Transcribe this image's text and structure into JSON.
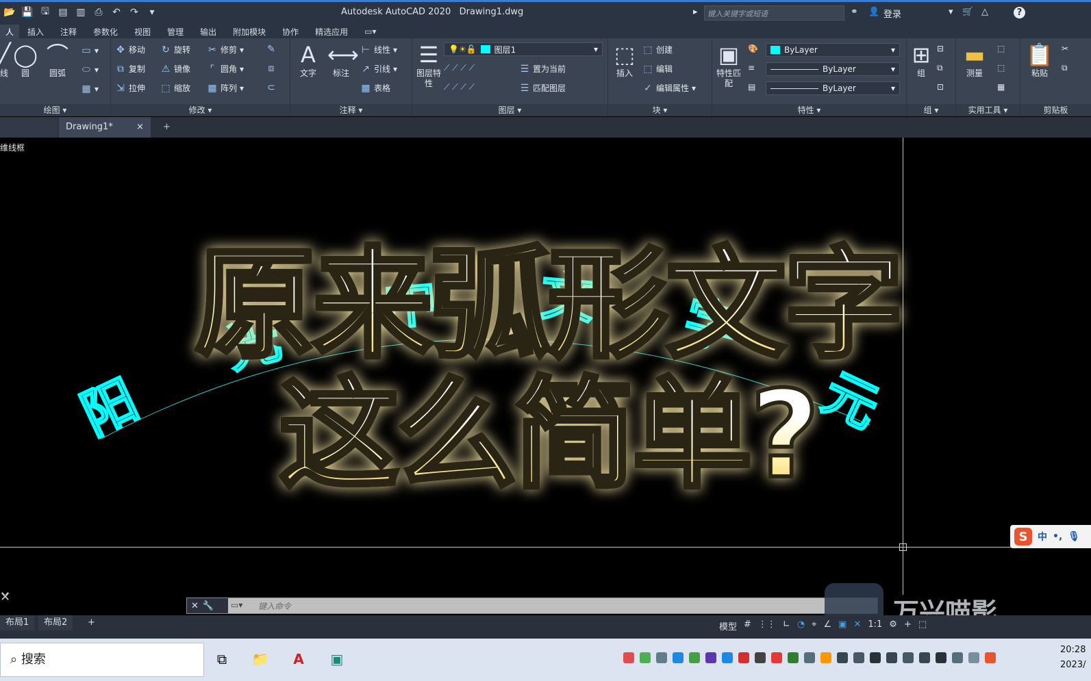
{
  "titlebar": {
    "app_title": "Autodesk AutoCAD 2020",
    "file_name": "Drawing1.dwg",
    "search_placeholder": "键入关键字或短语",
    "login_label": "登录",
    "help_label": "?"
  },
  "ribbon_tabs": [
    "人",
    "插入",
    "注释",
    "参数化",
    "视图",
    "管理",
    "输出",
    "附加模块",
    "协作",
    "精选应用"
  ],
  "ribbon": {
    "draw": {
      "label": "绘图",
      "items": [
        "线",
        "圆",
        "圆弧"
      ]
    },
    "modify": {
      "label": "修改",
      "items": [
        "移动",
        "旋转",
        "修剪",
        "复制",
        "镜像",
        "圆角",
        "拉伸",
        "缩放",
        "阵列"
      ]
    },
    "annotation": {
      "label": "注释",
      "text": "文字",
      "dim": "标注",
      "items": [
        "线性",
        "引线",
        "表格"
      ]
    },
    "layers": {
      "label": "图层",
      "props": "图层特性",
      "current_layer": "图层1",
      "items": [
        "置为当前",
        "匹配图层"
      ]
    },
    "block": {
      "label": "块",
      "insert": "插入",
      "items": [
        "创建",
        "编辑",
        "编辑属性"
      ]
    },
    "properties": {
      "label": "特性",
      "match": "特性匹配",
      "color": "ByLayer",
      "linetype": "ByLayer",
      "lineweight": "ByLayer"
    },
    "groups": {
      "label": "组",
      "group": "组"
    },
    "utilities": {
      "label": "实用工具",
      "measure": "测量"
    },
    "clipboard": {
      "label": "剪贴板",
      "paste": "粘贴"
    }
  },
  "doc_tabs": {
    "active": "Drawing1*",
    "close": "×",
    "add": "+"
  },
  "viewport": {
    "label": "维线框",
    "arc_chars": [
      "阳",
      "光",
      "中",
      "文",
      "字",
      "元"
    ]
  },
  "overlay": {
    "line1": "原来弧形文字",
    "line2": "这么简单?"
  },
  "ime": {
    "logo": "S",
    "lang": "中",
    "punct": "•,"
  },
  "command": {
    "placeholder": "键入命令"
  },
  "watermark": {
    "text": "万兴喵影"
  },
  "layout": {
    "tab1": "布局1",
    "tab2": "布局2",
    "add": "+",
    "model": "模型",
    "scale": "1:1"
  },
  "taskbar": {
    "search": "搜索",
    "time": "20:28",
    "date": "2023/"
  },
  "colors": {
    "accent_cyan": "#00ffff",
    "ribbon_bg": "#3a4453",
    "title_bg": "#2b3442"
  }
}
